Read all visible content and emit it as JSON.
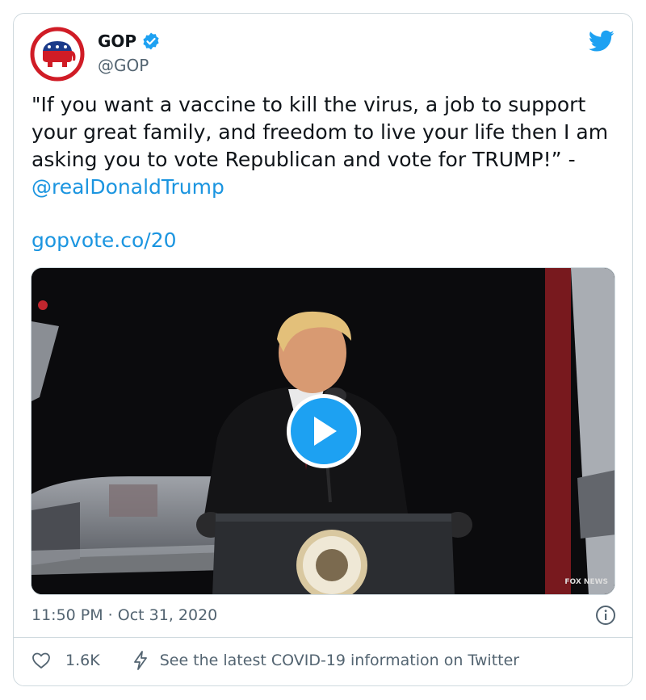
{
  "user": {
    "name": "GOP",
    "handle": "@GOP",
    "verified": true,
    "avatar_icon": "gop-elephant-logo"
  },
  "tweet": {
    "text_before": "\"If you want a vaccine to kill the virus, a job to support your great family, and freedom to live your life then I am asking you to vote Republican and vote for TRUMP!” -",
    "mention": "@realDonaldTrump",
    "link": "gopvote.co/20",
    "timestamp": "11:50 PM · Oct 31, 2020"
  },
  "media": {
    "type": "video",
    "play_icon": "play-icon",
    "watermark": "FOX NEWS"
  },
  "footer": {
    "likes": "1.6K",
    "covid_notice": "See the latest COVID-19 information on Twitter"
  },
  "colors": {
    "accent": "#1da1f2",
    "link": "#1b95e0",
    "secondary_text": "#536471",
    "border": "#cfd9de",
    "brand_red": "#d01c26"
  }
}
